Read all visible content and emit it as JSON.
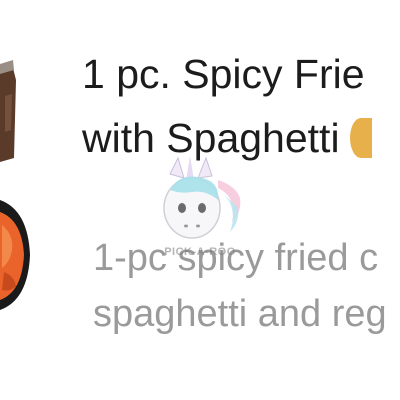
{
  "item": {
    "title_line1": "1 pc. Spicy Frie",
    "title_line2": "with Spaghetti",
    "description_line1": "1-pc spicy fried c",
    "description_line2": "spaghetti and reg",
    "thumbnail_icon": "food-photo-icon",
    "spice_indicator_icon": "spicy-indicator-icon"
  },
  "watermark": {
    "text": "PICK-A-ROO",
    "icon": "unicorn-logo-icon"
  },
  "colors": {
    "title": "#1c1c1c",
    "description": "#9a9a9a",
    "accent": "#e8b04a"
  }
}
